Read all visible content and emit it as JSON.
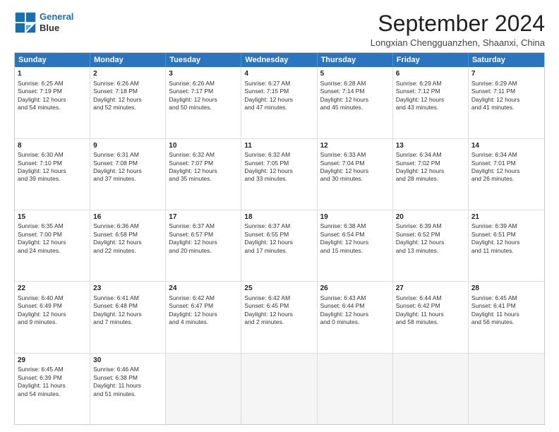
{
  "header": {
    "logo_line1": "General",
    "logo_line2": "Blue",
    "title": "September 2024",
    "subtitle": "Longxian Chengguanzhen, Shaanxi, China"
  },
  "days_of_week": [
    "Sunday",
    "Monday",
    "Tuesday",
    "Wednesday",
    "Thursday",
    "Friday",
    "Saturday"
  ],
  "weeks": [
    [
      {
        "day": "1",
        "lines": [
          "Sunrise: 6:25 AM",
          "Sunset: 7:19 PM",
          "Daylight: 12 hours",
          "and 54 minutes."
        ]
      },
      {
        "day": "2",
        "lines": [
          "Sunrise: 6:26 AM",
          "Sunset: 7:18 PM",
          "Daylight: 12 hours",
          "and 52 minutes."
        ]
      },
      {
        "day": "3",
        "lines": [
          "Sunrise: 6:26 AM",
          "Sunset: 7:17 PM",
          "Daylight: 12 hours",
          "and 50 minutes."
        ]
      },
      {
        "day": "4",
        "lines": [
          "Sunrise: 6:27 AM",
          "Sunset: 7:15 PM",
          "Daylight: 12 hours",
          "and 47 minutes."
        ]
      },
      {
        "day": "5",
        "lines": [
          "Sunrise: 6:28 AM",
          "Sunset: 7:14 PM",
          "Daylight: 12 hours",
          "and 45 minutes."
        ]
      },
      {
        "day": "6",
        "lines": [
          "Sunrise: 6:29 AM",
          "Sunset: 7:12 PM",
          "Daylight: 12 hours",
          "and 43 minutes."
        ]
      },
      {
        "day": "7",
        "lines": [
          "Sunrise: 6:29 AM",
          "Sunset: 7:11 PM",
          "Daylight: 12 hours",
          "and 41 minutes."
        ]
      }
    ],
    [
      {
        "day": "8",
        "lines": [
          "Sunrise: 6:30 AM",
          "Sunset: 7:10 PM",
          "Daylight: 12 hours",
          "and 39 minutes."
        ]
      },
      {
        "day": "9",
        "lines": [
          "Sunrise: 6:31 AM",
          "Sunset: 7:08 PM",
          "Daylight: 12 hours",
          "and 37 minutes."
        ]
      },
      {
        "day": "10",
        "lines": [
          "Sunrise: 6:32 AM",
          "Sunset: 7:07 PM",
          "Daylight: 12 hours",
          "and 35 minutes."
        ]
      },
      {
        "day": "11",
        "lines": [
          "Sunrise: 6:32 AM",
          "Sunset: 7:05 PM",
          "Daylight: 12 hours",
          "and 33 minutes."
        ]
      },
      {
        "day": "12",
        "lines": [
          "Sunrise: 6:33 AM",
          "Sunset: 7:04 PM",
          "Daylight: 12 hours",
          "and 30 minutes."
        ]
      },
      {
        "day": "13",
        "lines": [
          "Sunrise: 6:34 AM",
          "Sunset: 7:02 PM",
          "Daylight: 12 hours",
          "and 28 minutes."
        ]
      },
      {
        "day": "14",
        "lines": [
          "Sunrise: 6:34 AM",
          "Sunset: 7:01 PM",
          "Daylight: 12 hours",
          "and 26 minutes."
        ]
      }
    ],
    [
      {
        "day": "15",
        "lines": [
          "Sunrise: 6:35 AM",
          "Sunset: 7:00 PM",
          "Daylight: 12 hours",
          "and 24 minutes."
        ]
      },
      {
        "day": "16",
        "lines": [
          "Sunrise: 6:36 AM",
          "Sunset: 6:58 PM",
          "Daylight: 12 hours",
          "and 22 minutes."
        ]
      },
      {
        "day": "17",
        "lines": [
          "Sunrise: 6:37 AM",
          "Sunset: 6:57 PM",
          "Daylight: 12 hours",
          "and 20 minutes."
        ]
      },
      {
        "day": "18",
        "lines": [
          "Sunrise: 6:37 AM",
          "Sunset: 6:55 PM",
          "Daylight: 12 hours",
          "and 17 minutes."
        ]
      },
      {
        "day": "19",
        "lines": [
          "Sunrise: 6:38 AM",
          "Sunset: 6:54 PM",
          "Daylight: 12 hours",
          "and 15 minutes."
        ]
      },
      {
        "day": "20",
        "lines": [
          "Sunrise: 6:39 AM",
          "Sunset: 6:52 PM",
          "Daylight: 12 hours",
          "and 13 minutes."
        ]
      },
      {
        "day": "21",
        "lines": [
          "Sunrise: 6:39 AM",
          "Sunset: 6:51 PM",
          "Daylight: 12 hours",
          "and 11 minutes."
        ]
      }
    ],
    [
      {
        "day": "22",
        "lines": [
          "Sunrise: 6:40 AM",
          "Sunset: 6:49 PM",
          "Daylight: 12 hours",
          "and 9 minutes."
        ]
      },
      {
        "day": "23",
        "lines": [
          "Sunrise: 6:41 AM",
          "Sunset: 6:48 PM",
          "Daylight: 12 hours",
          "and 7 minutes."
        ]
      },
      {
        "day": "24",
        "lines": [
          "Sunrise: 6:42 AM",
          "Sunset: 6:47 PM",
          "Daylight: 12 hours",
          "and 4 minutes."
        ]
      },
      {
        "day": "25",
        "lines": [
          "Sunrise: 6:42 AM",
          "Sunset: 6:45 PM",
          "Daylight: 12 hours",
          "and 2 minutes."
        ]
      },
      {
        "day": "26",
        "lines": [
          "Sunrise: 6:43 AM",
          "Sunset: 6:44 PM",
          "Daylight: 12 hours",
          "and 0 minutes."
        ]
      },
      {
        "day": "27",
        "lines": [
          "Sunrise: 6:44 AM",
          "Sunset: 6:42 PM",
          "Daylight: 11 hours",
          "and 58 minutes."
        ]
      },
      {
        "day": "28",
        "lines": [
          "Sunrise: 6:45 AM",
          "Sunset: 6:41 PM",
          "Daylight: 11 hours",
          "and 56 minutes."
        ]
      }
    ],
    [
      {
        "day": "29",
        "lines": [
          "Sunrise: 6:45 AM",
          "Sunset: 6:39 PM",
          "Daylight: 11 hours",
          "and 54 minutes."
        ]
      },
      {
        "day": "30",
        "lines": [
          "Sunrise: 6:46 AM",
          "Sunset: 6:38 PM",
          "Daylight: 11 hours",
          "and 51 minutes."
        ]
      },
      {
        "day": "",
        "lines": [],
        "empty": true
      },
      {
        "day": "",
        "lines": [],
        "empty": true
      },
      {
        "day": "",
        "lines": [],
        "empty": true
      },
      {
        "day": "",
        "lines": [],
        "empty": true
      },
      {
        "day": "",
        "lines": [],
        "empty": true
      }
    ]
  ]
}
